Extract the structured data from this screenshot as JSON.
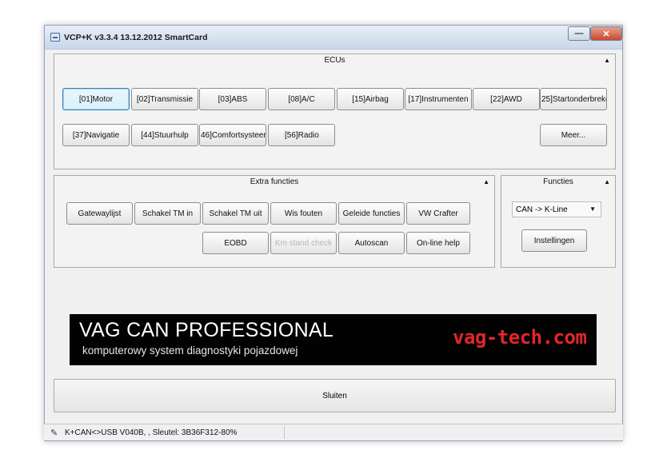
{
  "window": {
    "title": "VCP+K v3.3.4 13.12.2012 SmartCard"
  },
  "ecus": {
    "header": "ECUs",
    "row1": [
      "[01]Motor",
      "[02]Transmissie",
      "[03]ABS",
      "[08]A/C",
      "[15]Airbag",
      "[17]Instrumenten",
      "[22]AWD",
      "25]Startonderbreke"
    ],
    "row2": [
      "[37]Navigatie",
      "[44]Stuurhulp",
      "46]Comfortsysteer",
      "[56]Radio"
    ],
    "more": "Meer..."
  },
  "extra": {
    "header": "Extra functies",
    "row1": [
      "Gatewaylijst",
      "Schakel TM in",
      "Schakel TM uit",
      "Wis fouten",
      "Geleide functies",
      "VW Crafter"
    ],
    "row2": [
      "EOBD",
      "Km stand check",
      "Autoscan",
      "On-line help"
    ]
  },
  "functies": {
    "header": "Functies",
    "select_value": "CAN -> K-Line",
    "settings": "Instellingen"
  },
  "banner": {
    "title": "VAG CAN PROFESSIONAL",
    "subtitle": "komputerowy system diagnostyki pojazdowej",
    "site": "vag-tech.com"
  },
  "close": "Sluiten",
  "status": "K+CAN<>USB V040B, , Sleutel: 3B36F312-80%"
}
